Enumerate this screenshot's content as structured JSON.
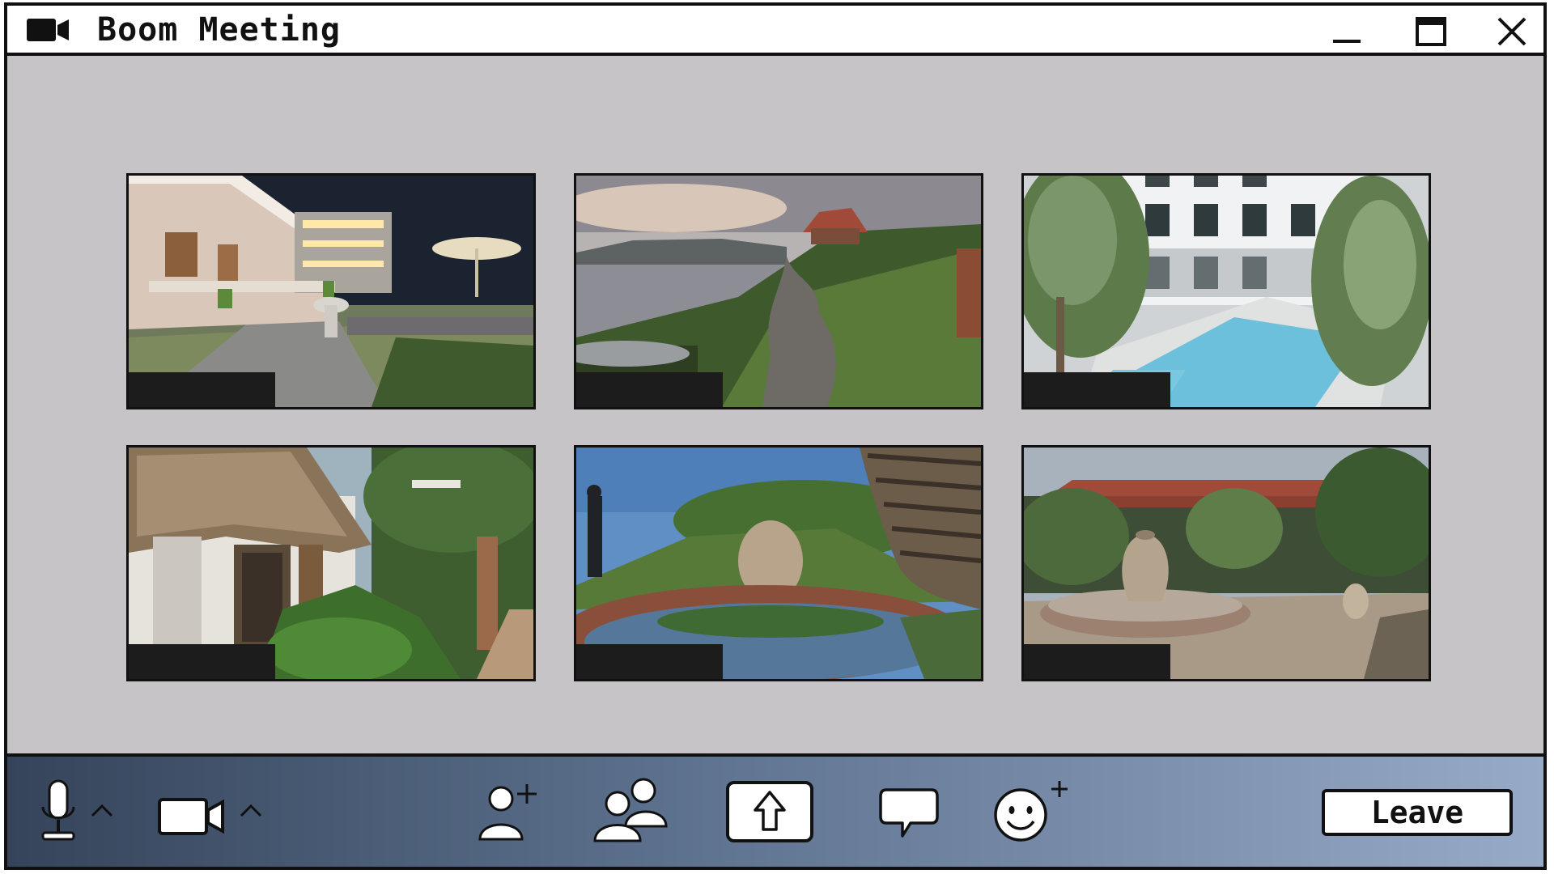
{
  "window": {
    "title": "Boom Meeting"
  },
  "participants": [
    {
      "scene": "resort-courtyard-night",
      "name": ""
    },
    {
      "scene": "seaside-hill-cottage",
      "name": ""
    },
    {
      "scene": "hotel-pool",
      "name": ""
    },
    {
      "scene": "thatched-hut-garden",
      "name": ""
    },
    {
      "scene": "garden-pond",
      "name": ""
    },
    {
      "scene": "courtyard-fountain",
      "name": ""
    }
  ],
  "toolbar": {
    "icons": [
      "microphone-icon",
      "camera-icon",
      "add-person-icon",
      "participants-icon",
      "share-screen-icon",
      "chat-icon",
      "reactions-icon"
    ],
    "leave_label": "Leave"
  },
  "colors": {
    "stage_bg": "#c6c4c7",
    "toolbar_left": "#35445a",
    "toolbar_right": "#97aac8",
    "border": "#111111",
    "nameplate": "#1c1c1c"
  }
}
